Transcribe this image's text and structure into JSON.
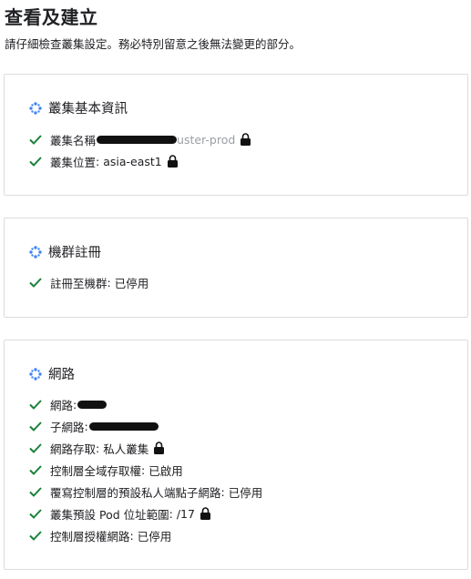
{
  "header": {
    "title": "查看及建立",
    "subtitle": "請仔細檢查叢集設定。務必特別留意之後無法變更的部分。"
  },
  "colors": {
    "check": "#188038",
    "icon_blue": "#4285f4",
    "border": "#dadce0",
    "text": "#202124"
  },
  "sections": [
    {
      "title": "叢集基本資訊",
      "rows": [
        {
          "label": "叢集名稱",
          "value": "[redacted]-cluster-prod",
          "visible_tail": "uster-prod",
          "locked": true
        },
        {
          "label": "叢集位置",
          "value": "asia-east1",
          "locked": true
        }
      ]
    },
    {
      "title": "機群註冊",
      "rows": [
        {
          "label": "註冊至機群",
          "value": "已停用",
          "locked": false
        }
      ]
    },
    {
      "title": "網路",
      "rows": [
        {
          "label": "網路",
          "value": "[redacted]",
          "locked": false
        },
        {
          "label": "子網路",
          "value": "[redacted]",
          "locked": false
        },
        {
          "label": "網路存取",
          "value": "私人叢集",
          "locked": true
        },
        {
          "label": "控制層全域存取權",
          "value": "已啟用",
          "locked": false
        },
        {
          "label": "覆寫控制層的預設私人端點子網路",
          "value": "已停用",
          "locked": false
        },
        {
          "label": "叢集預設 Pod 位址範圍",
          "value": "/17",
          "locked": true
        },
        {
          "label": "控制層授權網路",
          "value": "已停用",
          "locked": false
        }
      ]
    }
  ]
}
